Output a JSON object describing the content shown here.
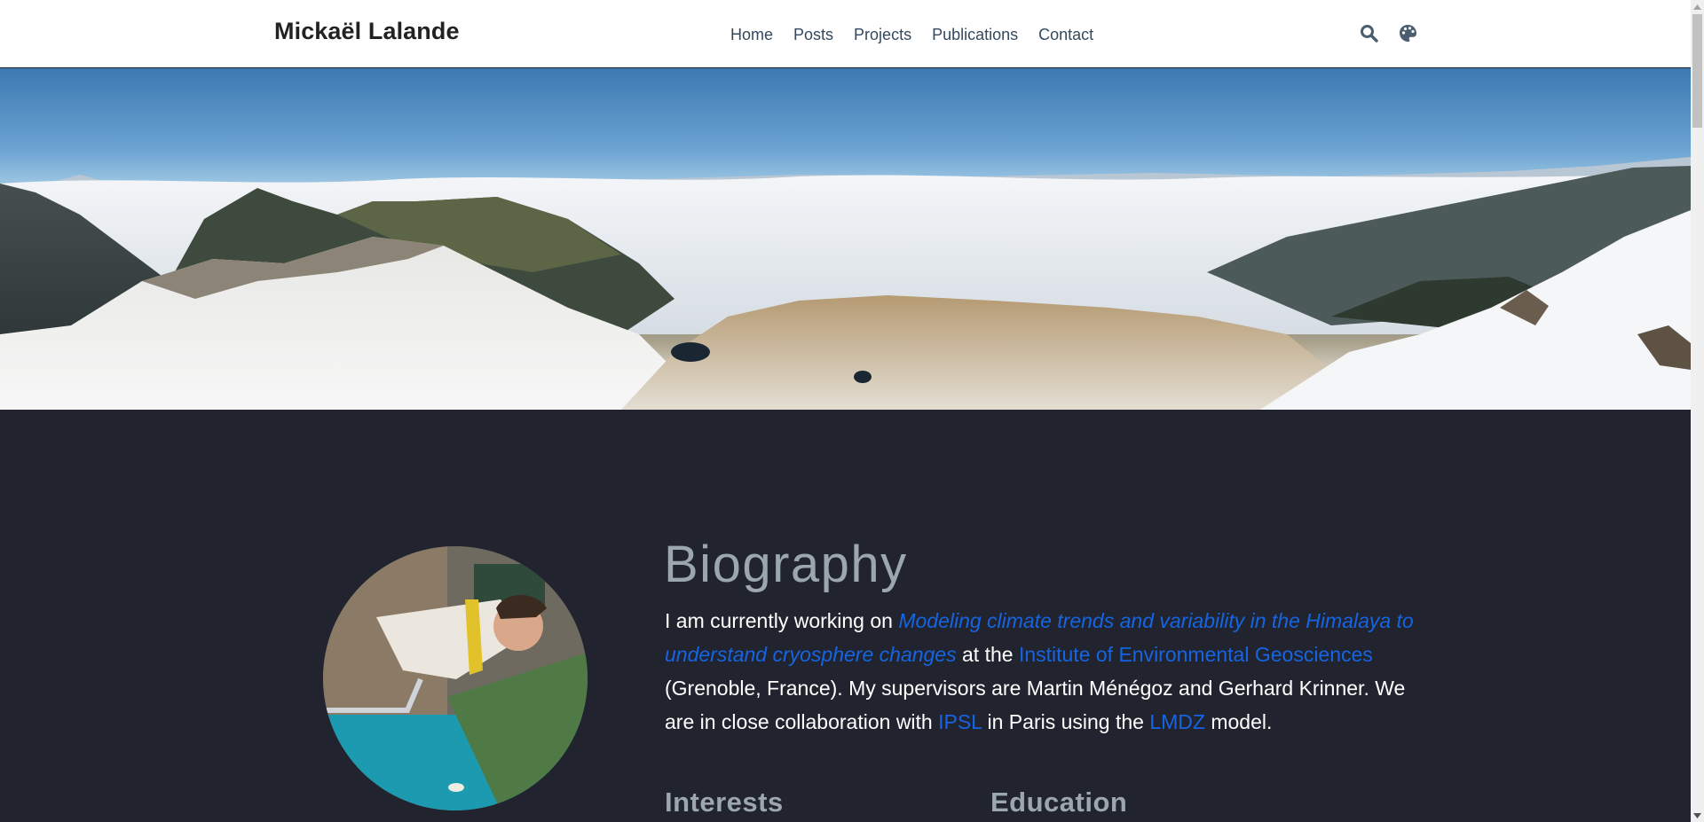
{
  "navbar": {
    "brand": "Mickaël Lalande",
    "links": [
      {
        "label": "Home"
      },
      {
        "label": "Posts"
      },
      {
        "label": "Projects"
      },
      {
        "label": "Publications"
      },
      {
        "label": "Contact"
      }
    ],
    "icons": [
      "search-icon",
      "palette-icon"
    ]
  },
  "hero": {
    "image": "mountain-panorama-above-clouds"
  },
  "about": {
    "avatar": "profile-photo-bungee-jump",
    "title": "Biography",
    "bio": {
      "t1": "I am currently working on ",
      "link1": "Modeling climate trends and variability in the Himalaya to understand cryosphere changes",
      "t2": " at the ",
      "link2": "Institute of Environmental Geosciences",
      "t3": " (Grenoble, France). My supervisors are Martin Ménégoz and Gerhard Krinner. We are in close collaboration with ",
      "link3": "IPSL",
      "t4": " in Paris using the ",
      "link4": "LMDZ",
      "t5": " model."
    },
    "interests_heading": "Interests",
    "education_heading": "Education"
  },
  "colors": {
    "nav_bg": "#ffffff",
    "nav_text": "#34495e",
    "body_bg": "#21232e",
    "link": "#1565e3",
    "heading": "#9ba6af"
  }
}
